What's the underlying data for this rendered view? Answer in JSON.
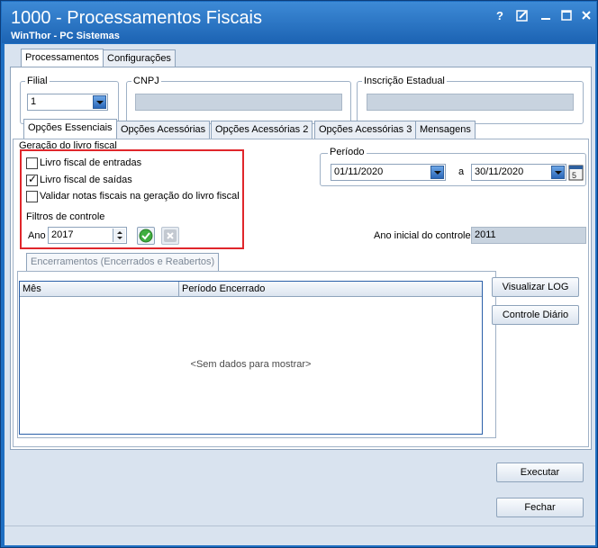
{
  "window": {
    "title": "1000 - Processamentos Fiscais",
    "subtitle": "WinThor - PC Sistemas",
    "controls": [
      "?",
      "⧉",
      "—",
      "□",
      "✕"
    ]
  },
  "main_tabs": [
    {
      "label": "Processamentos",
      "active": true
    },
    {
      "label": "Configurações",
      "active": false
    }
  ],
  "filial": {
    "label": "Filial",
    "value": "1"
  },
  "cnpj": {
    "label": "CNPJ",
    "value": ""
  },
  "inscricao": {
    "label": "Inscrição Estadual",
    "value": ""
  },
  "sub_tabs": [
    {
      "label": "Opções Essenciais",
      "active": true
    },
    {
      "label": "Opções Acessórias",
      "active": false
    },
    {
      "label": "Opções Acessórias 2",
      "active": false
    },
    {
      "label": "Opções Acessórias 3",
      "active": false
    },
    {
      "label": "Mensagens",
      "active": false
    }
  ],
  "geracao": {
    "label": "Geração do livro fiscal",
    "options": [
      {
        "label": "Livro fiscal de entradas",
        "checked": false
      },
      {
        "label": "Livro fiscal de saídas",
        "checked": true
      },
      {
        "label": "Validar notas fiscais na geração do livro fiscal",
        "checked": false
      }
    ]
  },
  "filtros": {
    "label": "Filtros de controle",
    "ano_label": "Ano",
    "ano_value": "2017"
  },
  "periodo": {
    "label": "Período",
    "start": "01/11/2020",
    "separator": "a",
    "end": "30/11/2020"
  },
  "ano_inicial": {
    "label": "Ano inicial do controle",
    "value": "2011"
  },
  "encerramentos": {
    "tab_label": "Encerramentos (Encerrados e Reabertos)",
    "columns": [
      "Mês",
      "Período Encerrado"
    ],
    "empty_text": "<Sem dados para mostrar>"
  },
  "buttons": {
    "visualizar_log": "Visualizar LOG",
    "controle_diario": "Controle Diário",
    "executar": "Executar",
    "fechar": "Fechar"
  },
  "colors": {
    "accent": "#1f6fc2",
    "highlight": "#e0262b",
    "confirm": "#3fae3f"
  }
}
